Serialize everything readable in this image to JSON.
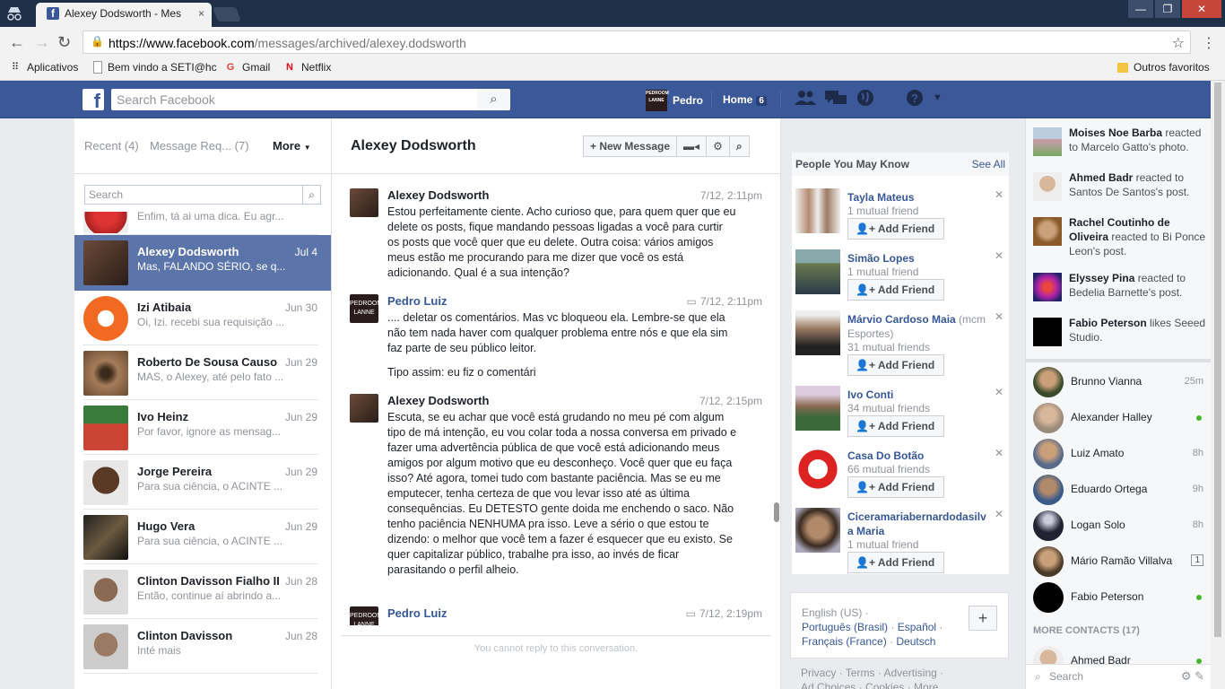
{
  "browser": {
    "tab_title": "Alexey Dodsworth - Mes",
    "tab_close": "×",
    "url_host": "https://www.facebook.com",
    "url_path": "/messages/archived/alexey.dodsworth",
    "bookmarks": [
      "Aplicativos",
      "Bem vindo a SETI@hc",
      "Gmail",
      "Netflix"
    ],
    "other_bookmarks": "Outros favoritos"
  },
  "fb_bar": {
    "search_placeholder": "Search Facebook",
    "profile_name": "Pedro",
    "home_label": "Home",
    "home_count": "6"
  },
  "left": {
    "tab_recent": "Recent (4)",
    "tab_requests": "Message Req... (7)",
    "more": "More",
    "search_placeholder": "Search",
    "threads": [
      {
        "name": "",
        "date": "",
        "snippet": "Enfim, tá ai uma dica. Eu agr..."
      },
      {
        "name": "Alexey Dodsworth",
        "date": "Jul 4",
        "snippet": "Mas, FALANDO SÉRIO, se q..."
      },
      {
        "name": "Izi Atibaia",
        "date": "Jun 30",
        "snippet": "Oi, Izi. recebi sua requisição ..."
      },
      {
        "name": "Roberto De Sousa Causo",
        "date": "Jun 29",
        "snippet": "MAS, o Alexey, até pelo fato ..."
      },
      {
        "name": "Ivo Heinz",
        "date": "Jun 29",
        "snippet": "Por favor, ignore as mensag..."
      },
      {
        "name": "Jorge Pereira",
        "date": "Jun 29",
        "snippet": "Para sua ciência, o ACINTE ..."
      },
      {
        "name": "Hugo Vera",
        "date": "Jun 29",
        "snippet": "Para sua ciência, o ACINTE ..."
      },
      {
        "name": "Clinton Davisson Fialho II",
        "date": "Jun 28",
        "snippet": "Então, continue aí abrindo a..."
      },
      {
        "name": "Clinton Davisson",
        "date": "Jun 28",
        "snippet": "Inté mais"
      }
    ]
  },
  "conversation": {
    "title": "Alexey Dodsworth",
    "new_message": "+ New Message",
    "no_reply": "You cannot reply to this conversation.",
    "messages": [
      {
        "sender": "Alexey Dodsworth",
        "time": "7/12, 2:11pm",
        "paragraphs": [
          "Estou perfeitamente ciente. Acho curioso que, para quem quer que eu delete os posts, fique mandando pessoas ligadas a você para curtir os posts que você quer que eu delete. Outra coisa: vários amigos meus estão me procurando para me dizer que você os está adicionando. Qual é a sua intenção?"
        ]
      },
      {
        "sender": "Pedro Luiz",
        "time": "7/12, 2:11pm",
        "paragraphs": [
          ".... deletar os comentários. Mas vc bloqueou ela. Lembre-se que ela não tem nada haver com qualquer problema entre nós e que ela sim faz parte de seu público leitor.",
          "Tipo assim: eu fiz o comentári"
        ]
      },
      {
        "sender": "Alexey Dodsworth",
        "time": "7/12, 2:15pm",
        "paragraphs": [
          "Escuta, se eu achar que você está grudando no meu pé com algum tipo de má intenção, eu vou colar toda a nossa conversa em privado e fazer uma advertência pública de que você está adicionando meus amigos por algum motivo que eu desconheço. Você quer que eu faça isso? Até agora, tomei tudo com bastante paciência. Mas se eu me emputecer, tenha certeza de que vou levar isso até as última consequências. Eu DETESTO gente doida me enchendo o saco. Não tenho paciência NENHUMA pra isso. Leve a sério o que estou te dizendo: o melhor que você tem a fazer é esquecer que eu existo. Se quer capitalizar público, trabalhe pra isso, ao invés de ficar parasitando o perfil alheio."
        ]
      },
      {
        "sender": "Pedro Luiz",
        "time": "7/12, 2:19pm",
        "paragraphs": []
      }
    ]
  },
  "pymk": {
    "title": "People You May Know",
    "see_all": "See All",
    "add_label": "Add Friend",
    "items": [
      {
        "name": "Tayla Mateus",
        "sub": "",
        "mutual": "1 mutual friend"
      },
      {
        "name": "Simão Lopes",
        "sub": "",
        "mutual": "1 mutual friend"
      },
      {
        "name": "Márvio Cardoso Maia",
        "sub": " (mcm Esportes)",
        "mutual": "31 mutual friends"
      },
      {
        "name": "Ivo Conti",
        "sub": "",
        "mutual": "34 mutual friends"
      },
      {
        "name": "Casa Do Botão",
        "sub": "",
        "mutual": "66 mutual friends"
      },
      {
        "name": "Ciceramariabernardodasilva Maria",
        "sub": "",
        "mutual": "1 mutual friend"
      }
    ]
  },
  "languages": {
    "current": "English (US) ·",
    "line2a": "Português (Brasil)",
    "line2b": "Español",
    "line3a": "Français (France)",
    "line3b": "Deutsch"
  },
  "footer": {
    "line1": "Privacy · Terms · Advertising ·",
    "line2": "Ad Choices · Cookies · More"
  },
  "ticker": [
    {
      "name": "Moises Noe Barba",
      "text": " reacted to Marcelo Gatto's photo."
    },
    {
      "name": "Ahmed Badr",
      "text": " reacted to Santos De Santos's post."
    },
    {
      "name": "Rachel Coutinho de Oliveira",
      "text": " reacted to Bi Ponce Leon's post."
    },
    {
      "name": "Elyssey Pina",
      "text": " reacted to Bedelia Barnette's post."
    },
    {
      "name": "Fabio Peterson",
      "text": " likes Seeed Studio."
    }
  ],
  "chat": {
    "contacts": [
      {
        "name": "Brunno Vianna",
        "status": "25m"
      },
      {
        "name": "Alexander Halley",
        "status": "online"
      },
      {
        "name": "Luiz Amato",
        "status": "8h"
      },
      {
        "name": "Eduardo Ortega",
        "status": "9h"
      },
      {
        "name": "Logan Solo",
        "status": "8h"
      },
      {
        "name": "Mário Ramão Villalva",
        "status": "1"
      },
      {
        "name": "Fabio Peterson",
        "status": "online"
      }
    ],
    "more_contacts": "MORE CONTACTS (17)",
    "peek_name": "Ahmed Badr",
    "search_placeholder": "Search"
  },
  "colors": {
    "fb_blue": "#3b5998",
    "link": "#365899",
    "active_thread": "#5b75ab",
    "online": "#42b72a"
  }
}
